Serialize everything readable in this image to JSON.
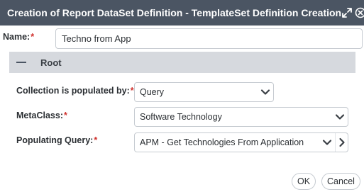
{
  "window": {
    "title": "Creation of Report DataSet Definition - TemplateSet Definition Creation",
    "expand_icon": "expand-arrows-icon",
    "close_icon": "close-circle-icon"
  },
  "name_field": {
    "label": "Name:",
    "required_mark": "*",
    "value": "Techno from App"
  },
  "section": {
    "title": "Root",
    "collapse_icon": "minus-icon"
  },
  "collection": {
    "label": "Collection is populated by:",
    "required_mark": "*",
    "value": "Query"
  },
  "metaclass": {
    "label": "MetaClass:",
    "required_mark": "*",
    "value": "Software Technology"
  },
  "query": {
    "label": "Populating Query:",
    "required_mark": "*",
    "value": "APM - Get Technologies From Application"
  },
  "buttons": {
    "ok": "OK",
    "cancel": "Cancel"
  },
  "colors": {
    "titlebar": "#4b5563",
    "section_header": "#d6d9de",
    "required": "#d0312d"
  }
}
